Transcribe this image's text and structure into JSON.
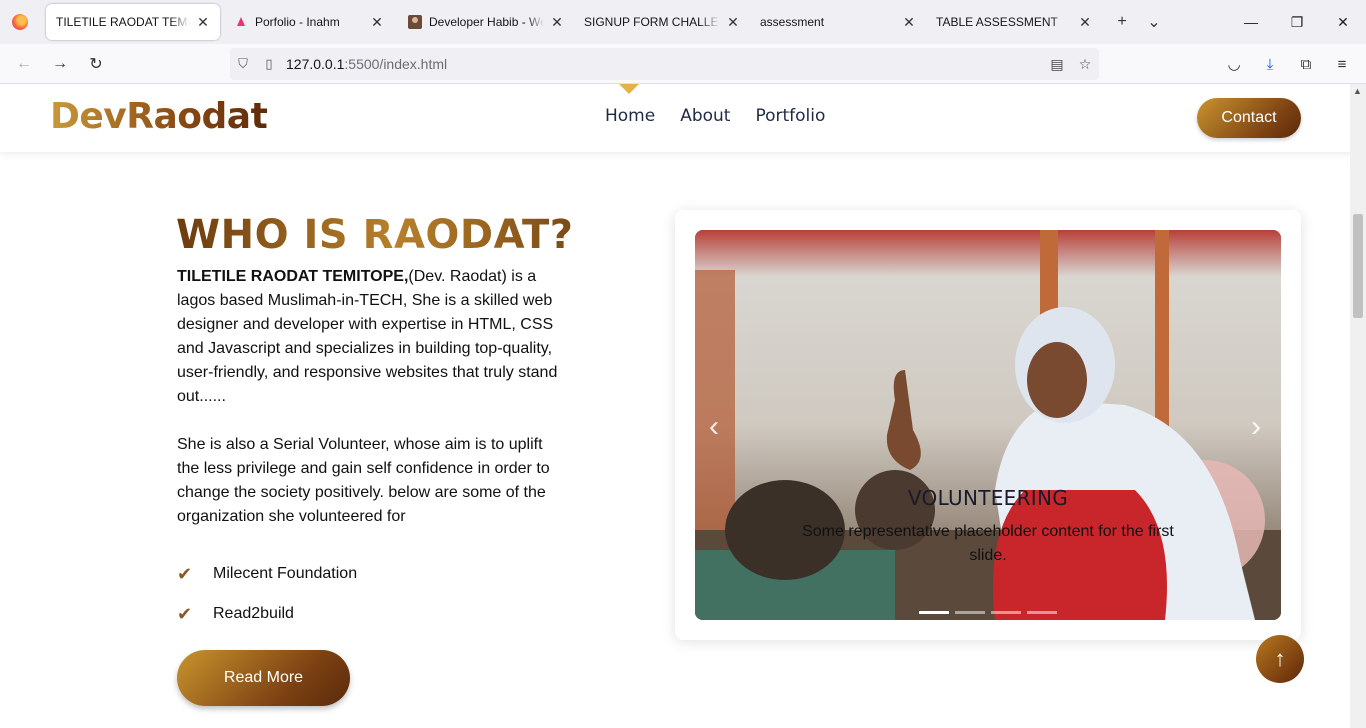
{
  "browser": {
    "tabs": [
      {
        "title": "TILETILE RAODAT TEMITOPE",
        "active": true
      },
      {
        "title": "Porfolio - Inahm",
        "active": false
      },
      {
        "title": "Developer Habib - Web",
        "active": false
      },
      {
        "title": "SIGNUP FORM CHALLENGE",
        "active": false
      },
      {
        "title": "assessment",
        "active": false
      },
      {
        "title": "TABLE ASSESSMENT",
        "active": false
      }
    ],
    "url_host": "127.0.0.1",
    "url_path": ":5500/index.html"
  },
  "site": {
    "brand": "DevRaodat",
    "nav": [
      "Home",
      "About",
      "Portfolio"
    ],
    "contact_label": "Contact"
  },
  "about": {
    "title": "WHO IS RAODAT?",
    "name_bold": "TILETILE RAODAT TEMITOPE,",
    "para1_rest": "(Dev. Raodat) is a lagos based Muslimah-in-TECH, She is a skilled web designer and developer with expertise in HTML, CSS and Javascript and specializes in building top-quality, user-friendly, and responsive websites that truly stand out......",
    "para2": "She is also a Serial Volunteer, whose aim is to uplift the less privilege and gain self confidence in order to change the society positively. below are some of the organization she volunteered for",
    "list": [
      "Milecent Foundation",
      "Read2build"
    ],
    "read_more": "Read More"
  },
  "carousel": {
    "caption_title": "VOLUNTEERING",
    "caption_text": "Some representative placeholder content for the first slide.",
    "prev_glyph": "‹",
    "next_glyph": "›",
    "indicator_count": 4,
    "active_index": 0
  },
  "to_top_glyph": "↑"
}
